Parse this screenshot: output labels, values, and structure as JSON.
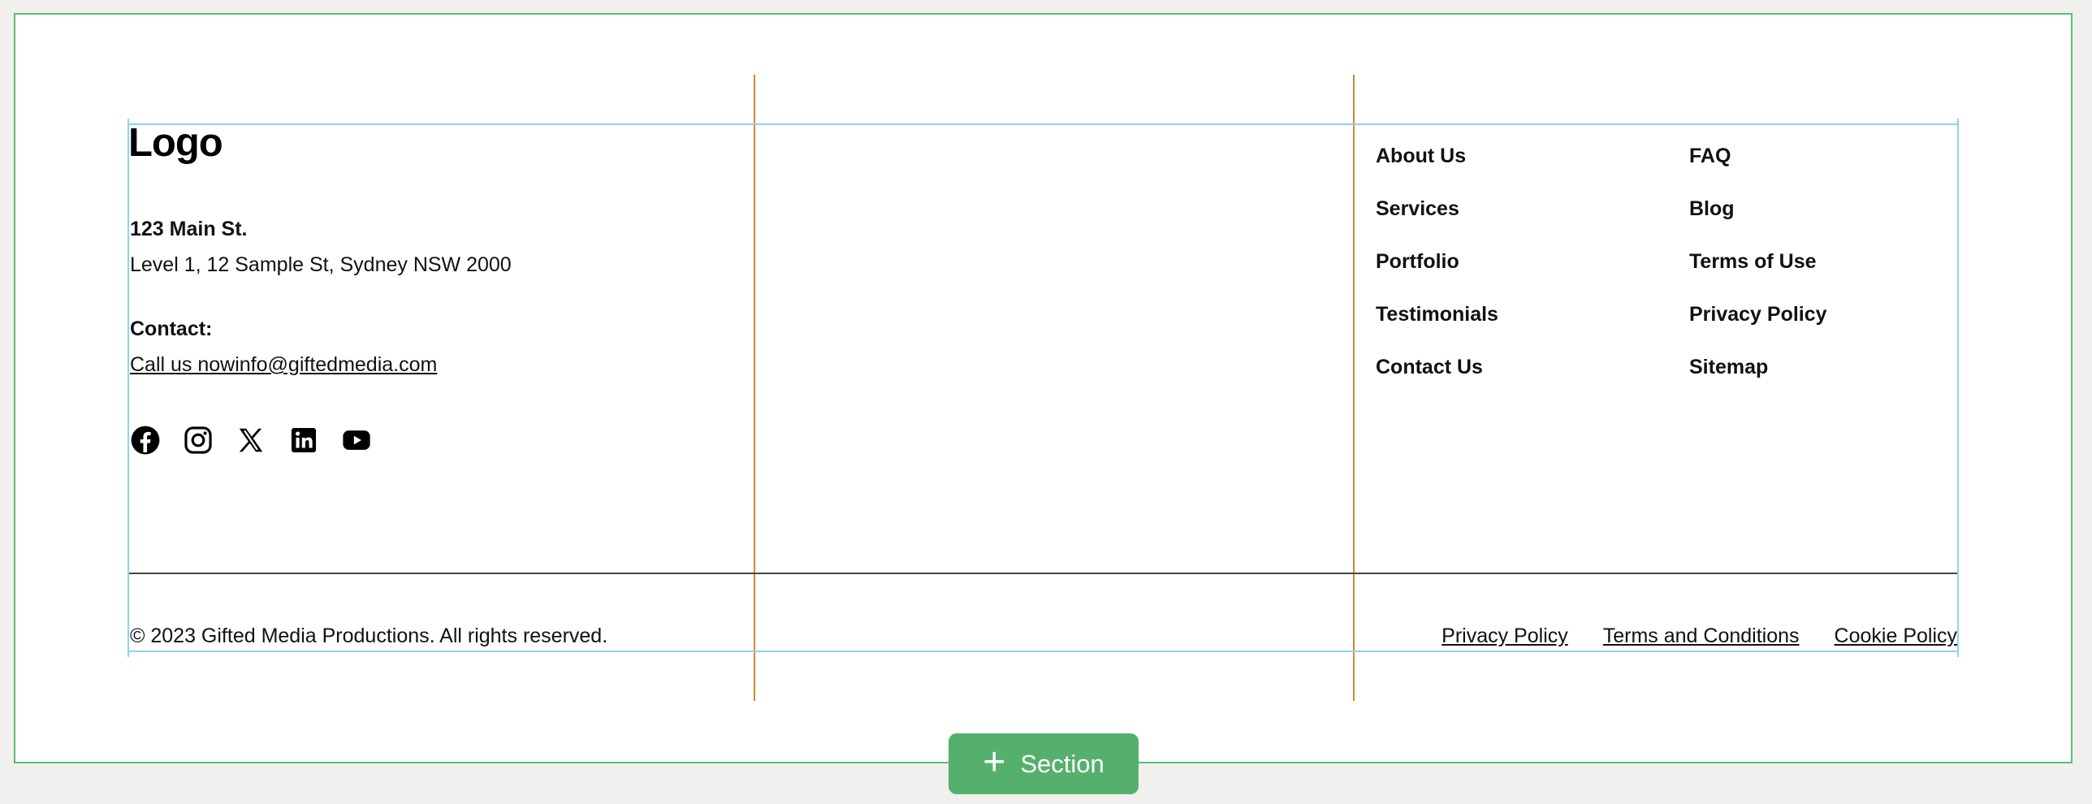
{
  "footer": {
    "logo": "Logo",
    "address_title": "123 Main St.",
    "address_line": "Level 1, 12 Sample St, Sydney NSW 2000",
    "contact_title": "Contact:",
    "contact_link": "Call us nowinfo@giftedmedia.com",
    "socials": [
      "facebook-icon",
      "instagram-icon",
      "x-icon",
      "linkedin-icon",
      "youtube-icon"
    ],
    "nav_col1": [
      "About Us",
      "Services",
      "Portfolio",
      "Testimonials",
      "Contact Us"
    ],
    "nav_col2": [
      "FAQ",
      "Blog",
      "Terms of Use",
      "Privacy Policy",
      "Sitemap"
    ],
    "copyright": "© 2023 Gifted Media Productions. All rights reserved.",
    "legal": [
      "Privacy Policy",
      "Terms and Conditions",
      "Cookie Policy"
    ]
  },
  "editor": {
    "add_section_plus": "+",
    "add_section_label": "Section",
    "colors": {
      "canvas_border": "#5bbd74",
      "column_guide": "#d08a2e",
      "container_guide": "#8fd3ee",
      "add_button": "#55b06e",
      "background": "#f1f0ee"
    }
  }
}
